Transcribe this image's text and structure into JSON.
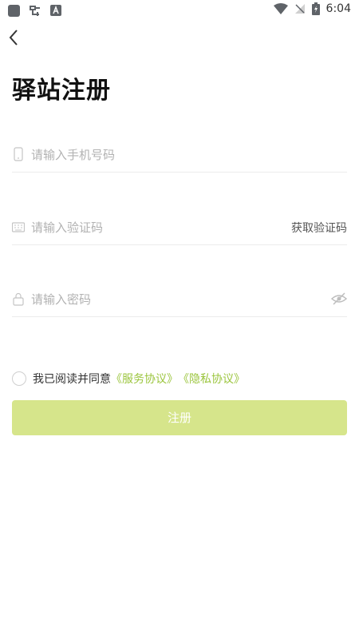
{
  "status_bar": {
    "time": "6:04",
    "notification_icons": [
      "app-square-icon",
      "bug-icon",
      "text-a-icon"
    ]
  },
  "header": {
    "title": "驿站注册"
  },
  "form": {
    "phone": {
      "placeholder": "请输入手机号码",
      "value": ""
    },
    "code": {
      "placeholder": "请输入验证码",
      "value": "",
      "get_code_label": "获取验证码"
    },
    "password": {
      "placeholder": "请输入密码",
      "value": ""
    }
  },
  "agreement": {
    "prefix": "我已阅读并同意",
    "service_link": "《服务协议》",
    "privacy_link": "《隐私协议》",
    "checked": false
  },
  "register_button": {
    "label": "注册"
  },
  "colors": {
    "accent": "#9bc53d",
    "button_disabled": "#d6e58b",
    "divider": "#ececec"
  }
}
